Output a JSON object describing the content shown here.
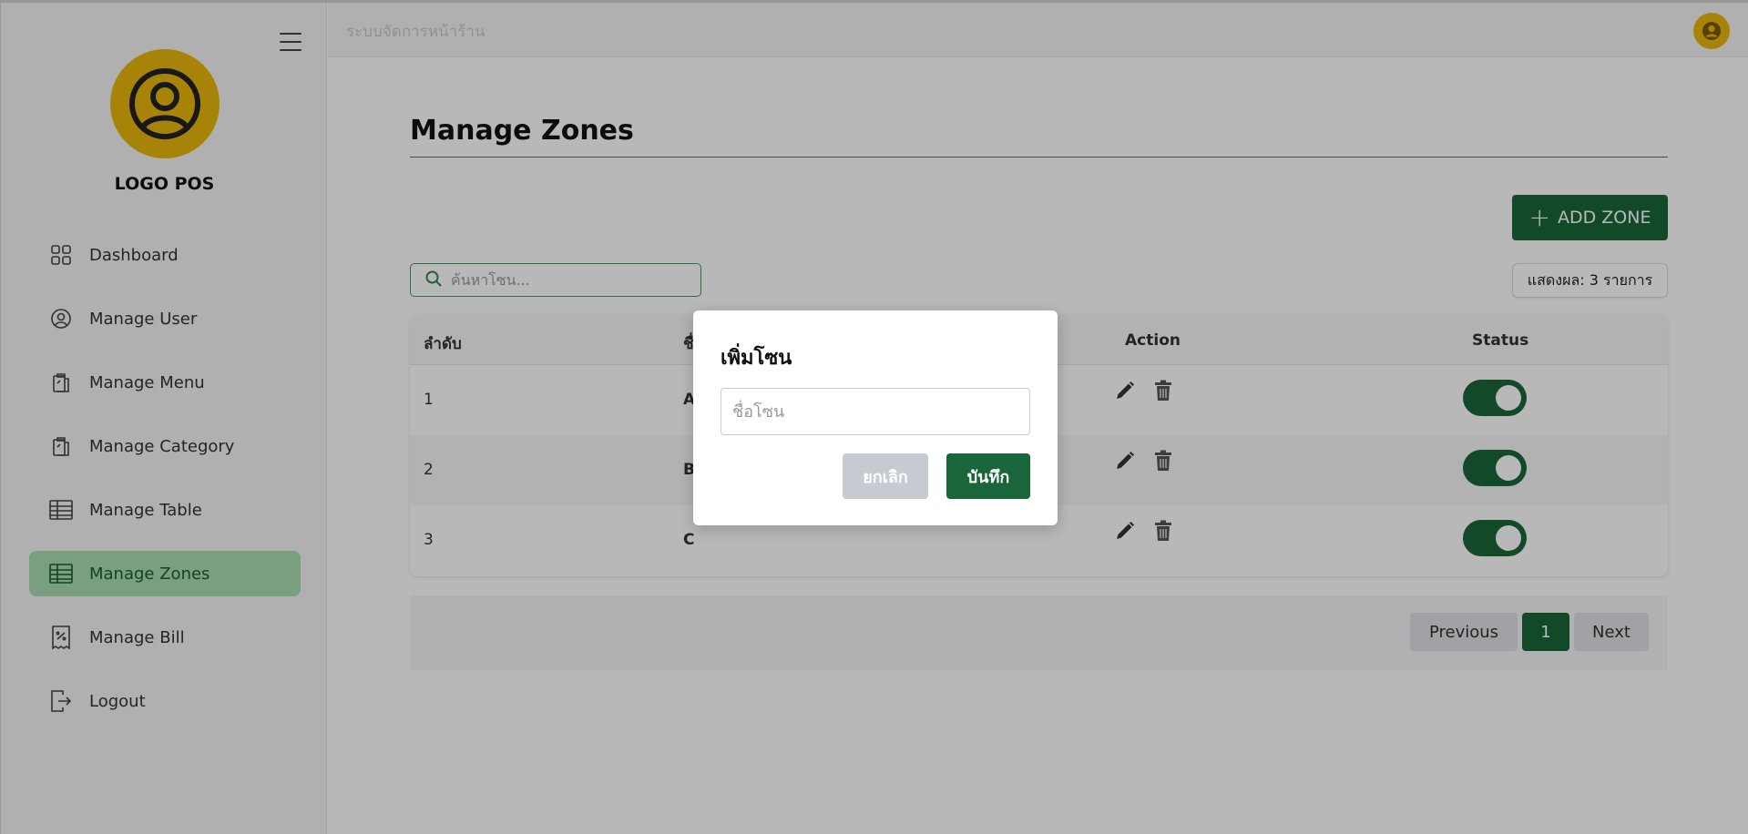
{
  "sidebar": {
    "logo_text": "LOGO POS",
    "items": [
      {
        "label": "Dashboard",
        "icon": "grid-icon"
      },
      {
        "label": "Manage User",
        "icon": "user-circle-icon"
      },
      {
        "label": "Manage Menu",
        "icon": "clipboard-icon"
      },
      {
        "label": "Manage Category",
        "icon": "clipboard-icon"
      },
      {
        "label": "Manage Table",
        "icon": "table-icon"
      },
      {
        "label": "Manage Zones",
        "icon": "table-icon",
        "active": true
      },
      {
        "label": "Manage Bill",
        "icon": "receipt-icon"
      },
      {
        "label": "Logout",
        "icon": "logout-icon"
      }
    ]
  },
  "topbar": {
    "title": "ระบบจัดการหน้าร้าน"
  },
  "main": {
    "page_title": "Manage Zones",
    "add_button_label": "ADD ZONE",
    "search_placeholder": "ค้นหาโซน...",
    "count_label": "แสดงผล: 3 รายการ",
    "table": {
      "columns": [
        "ลำดับ",
        "ชื่อโซน",
        "Action",
        "Status"
      ],
      "rows": [
        {
          "no": "1",
          "name": "A",
          "status_on": true
        },
        {
          "no": "2",
          "name": "B",
          "status_on": true
        },
        {
          "no": "3",
          "name": "C",
          "status_on": true
        }
      ]
    },
    "pagination": {
      "previous": "Previous",
      "current_page": "1",
      "next": "Next"
    }
  },
  "modal": {
    "title": "เพิ่มโซน",
    "input_placeholder": "ชื่อโซน",
    "cancel_label": "ยกเลิก",
    "save_label": "บันทึก"
  },
  "colors": {
    "primary_green": "#19663a",
    "accent_yellow": "#e8b70c",
    "active_nav_bg": "#a8dcb2"
  }
}
